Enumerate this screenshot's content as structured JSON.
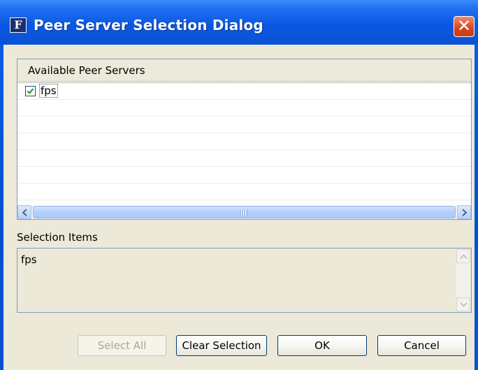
{
  "window": {
    "title": "Peer Server Selection Dialog",
    "icon_letter": "F",
    "close_glyph": "✕"
  },
  "table": {
    "header": "Available Peer Servers",
    "rows": [
      {
        "label": "fps",
        "checked": true
      },
      {
        "label": "",
        "checked": false
      },
      {
        "label": "",
        "checked": false
      },
      {
        "label": "",
        "checked": false
      },
      {
        "label": "",
        "checked": false
      },
      {
        "label": "",
        "checked": false
      },
      {
        "label": "",
        "checked": false
      }
    ]
  },
  "selection": {
    "label": "Selection Items",
    "value": "fps"
  },
  "buttons": {
    "select_all": "Select All",
    "clear_selection": "Clear Selection",
    "ok": "OK",
    "cancel": "Cancel"
  },
  "colors": {
    "titlebar": "#0a58e2",
    "dialog_bg": "#ece9d8",
    "check_green": "#21a121",
    "close_red": "#d6451f"
  },
  "icons": {
    "app": "app-icon",
    "close": "close-icon",
    "check": "checkmark-icon",
    "scroll_left": "arrow-left-icon",
    "scroll_right": "arrow-right-icon",
    "scroll_up": "arrow-up-icon",
    "scroll_down": "arrow-down-icon"
  }
}
